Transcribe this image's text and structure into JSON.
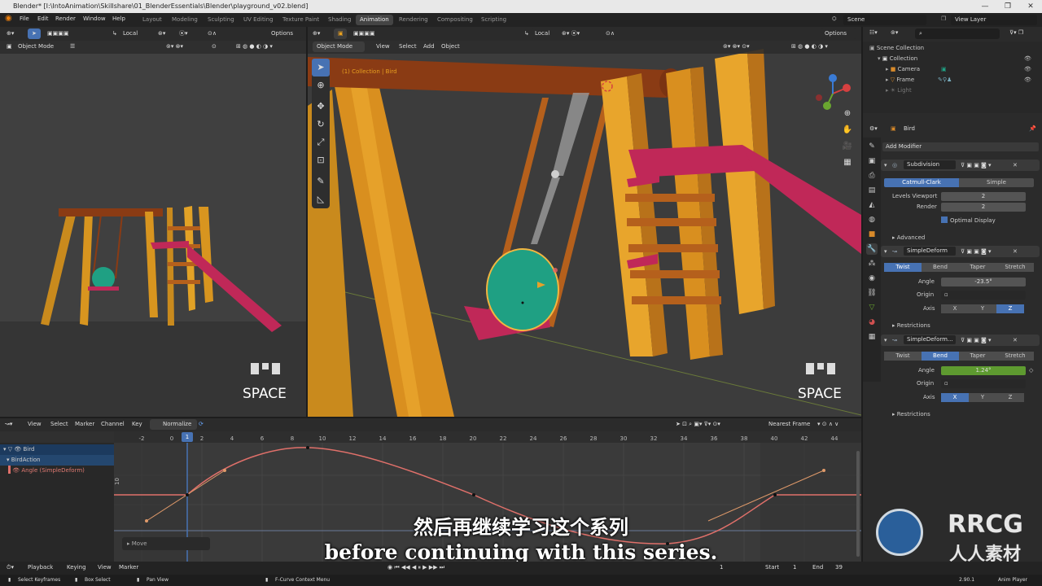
{
  "window": {
    "title": "Blender* [I:\\IntoAnimation\\Skillshare\\01_BlenderEssentials\\Blender\\playground_v02.blend]"
  },
  "menu": [
    "File",
    "Edit",
    "Render",
    "Window",
    "Help"
  ],
  "workspaces": [
    {
      "label": "Layout",
      "active": false
    },
    {
      "label": "Modeling",
      "active": false
    },
    {
      "label": "Sculpting",
      "active": false
    },
    {
      "label": "UV Editing",
      "active": false
    },
    {
      "label": "Texture Paint",
      "active": false
    },
    {
      "label": "Shading",
      "active": false
    },
    {
      "label": "Animation",
      "active": true
    },
    {
      "label": "Rendering",
      "active": false
    },
    {
      "label": "Compositing",
      "active": false
    },
    {
      "label": "Scripting",
      "active": false
    }
  ],
  "scene": {
    "name": "Scene",
    "view_layer": "View Layer"
  },
  "left_view": {
    "transform": "Local",
    "options": "Options",
    "mode": "Object Mode",
    "key_overlay": "SPACE"
  },
  "main_view": {
    "transform": "Local",
    "options": "Options",
    "mode": "Object Mode",
    "menus": [
      "View",
      "Select",
      "Add",
      "Object"
    ],
    "overlay_text": "(1) Collection | Bird",
    "key_overlay": "SPACE"
  },
  "outliner": {
    "root": "Scene Collection",
    "items": [
      {
        "label": "Collection",
        "level": 1
      },
      {
        "label": "Camera",
        "level": 2
      },
      {
        "label": "Frame",
        "level": 2
      },
      {
        "label": "Light",
        "level": 2
      }
    ]
  },
  "properties": {
    "object": "Bird",
    "add_modifier": "Add Modifier",
    "subdivision": {
      "name": "Subdivision",
      "types": [
        "Catmull-Clark",
        "Simple"
      ],
      "active_type": 0,
      "levels_viewport_label": "Levels Viewport",
      "levels_viewport": "2",
      "render_label": "Render",
      "render": "2",
      "optimal_display": "Optimal Display",
      "advanced": "Advanced"
    },
    "deform1": {
      "name": "SimpleDeform",
      "modes": [
        "Twist",
        "Bend",
        "Taper",
        "Stretch"
      ],
      "active_mode": 0,
      "angle_label": "Angle",
      "angle": "-23.5°",
      "origin_label": "Origin",
      "axis_label": "Axis",
      "axes": [
        "X",
        "Y",
        "Z"
      ],
      "active_axis": 2,
      "restrictions": "Restrictions"
    },
    "deform2": {
      "name": "SimpleDeform...",
      "modes": [
        "Twist",
        "Bend",
        "Taper",
        "Stretch"
      ],
      "active_mode": 1,
      "angle_label": "Angle",
      "angle": "1.24°",
      "origin_label": "Origin",
      "axis_label": "Axis",
      "axes": [
        "X",
        "Y",
        "Z"
      ],
      "active_axis": 0,
      "restrictions": "Restrictions"
    }
  },
  "graph": {
    "menus": [
      "View",
      "Select",
      "Marker",
      "Channel",
      "Key"
    ],
    "normalize": "Normalize",
    "snap": "Nearest Frame",
    "current_frame": "1",
    "frame_ticks": [
      "-2",
      "0",
      "2",
      "4",
      "6",
      "8",
      "10",
      "12",
      "14",
      "16",
      "18",
      "20",
      "22",
      "24",
      "26",
      "28",
      "30",
      "32",
      "34",
      "36",
      "38",
      "40",
      "42",
      "44"
    ],
    "y_tick": "10",
    "channels": [
      "Bird",
      "BirdAction",
      "Angle (SimpleDeform)"
    ],
    "move_panel": "Move",
    "curve_color": "#e0706a"
  },
  "timeline": {
    "menus": [
      "Playback",
      "Keying",
      "View",
      "Marker"
    ],
    "frame": "1",
    "start_label": "Start",
    "start": "1",
    "end_label": "End",
    "end": "39"
  },
  "statusbar": {
    "items": [
      "Select Keyframes",
      "Box Select",
      "Pan View",
      "F-Curve Context Menu"
    ],
    "version": "2.90.1",
    "player": "Anim Player"
  },
  "subtitles": {
    "cn": "然后再继续学习这个系列",
    "en": "before continuing with this series."
  },
  "watermark": {
    "logo": "RRCG",
    "sub": "人人素材"
  }
}
